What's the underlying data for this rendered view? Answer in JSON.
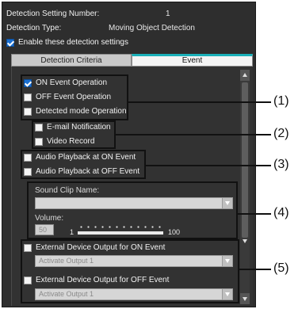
{
  "header": {
    "setting_number_label": "Detection Setting Number:",
    "setting_number_value": "1",
    "type_label": "Detection Type:",
    "type_value": "Moving Object Detection",
    "enable_label": "Enable these detection settings",
    "enable_checked": true
  },
  "tabs": [
    {
      "label": "Detection Criteria",
      "active": false
    },
    {
      "label": "Event",
      "active": true
    }
  ],
  "event": {
    "group1": [
      {
        "label": "ON Event Operation",
        "checked": true
      },
      {
        "label": "OFF Event Operation",
        "checked": false
      },
      {
        "label": "Detected mode Operation",
        "checked": false
      }
    ],
    "group2": [
      {
        "label": "E-mail Notification",
        "checked": false
      },
      {
        "label": "Video Record",
        "checked": false
      }
    ],
    "group3": [
      {
        "label": "Audio Playback at ON Event",
        "checked": false
      },
      {
        "label": "Audio Playback at OFF Event",
        "checked": false
      }
    ],
    "sound": {
      "clip_label": "Sound Clip Name:",
      "clip_value": "",
      "volume_label": "Volume:",
      "volume_value": "50",
      "slider_min": "1",
      "slider_max": "100"
    },
    "output": {
      "on_label": "External Device Output for ON Event",
      "on_value": "Activate Output 1",
      "off_label": "External Device Output for OFF Event",
      "off_value": "Activate Output 1"
    }
  },
  "callouts": [
    "(1)",
    "(2)",
    "(3)",
    "(4)",
    "(5)"
  ]
}
